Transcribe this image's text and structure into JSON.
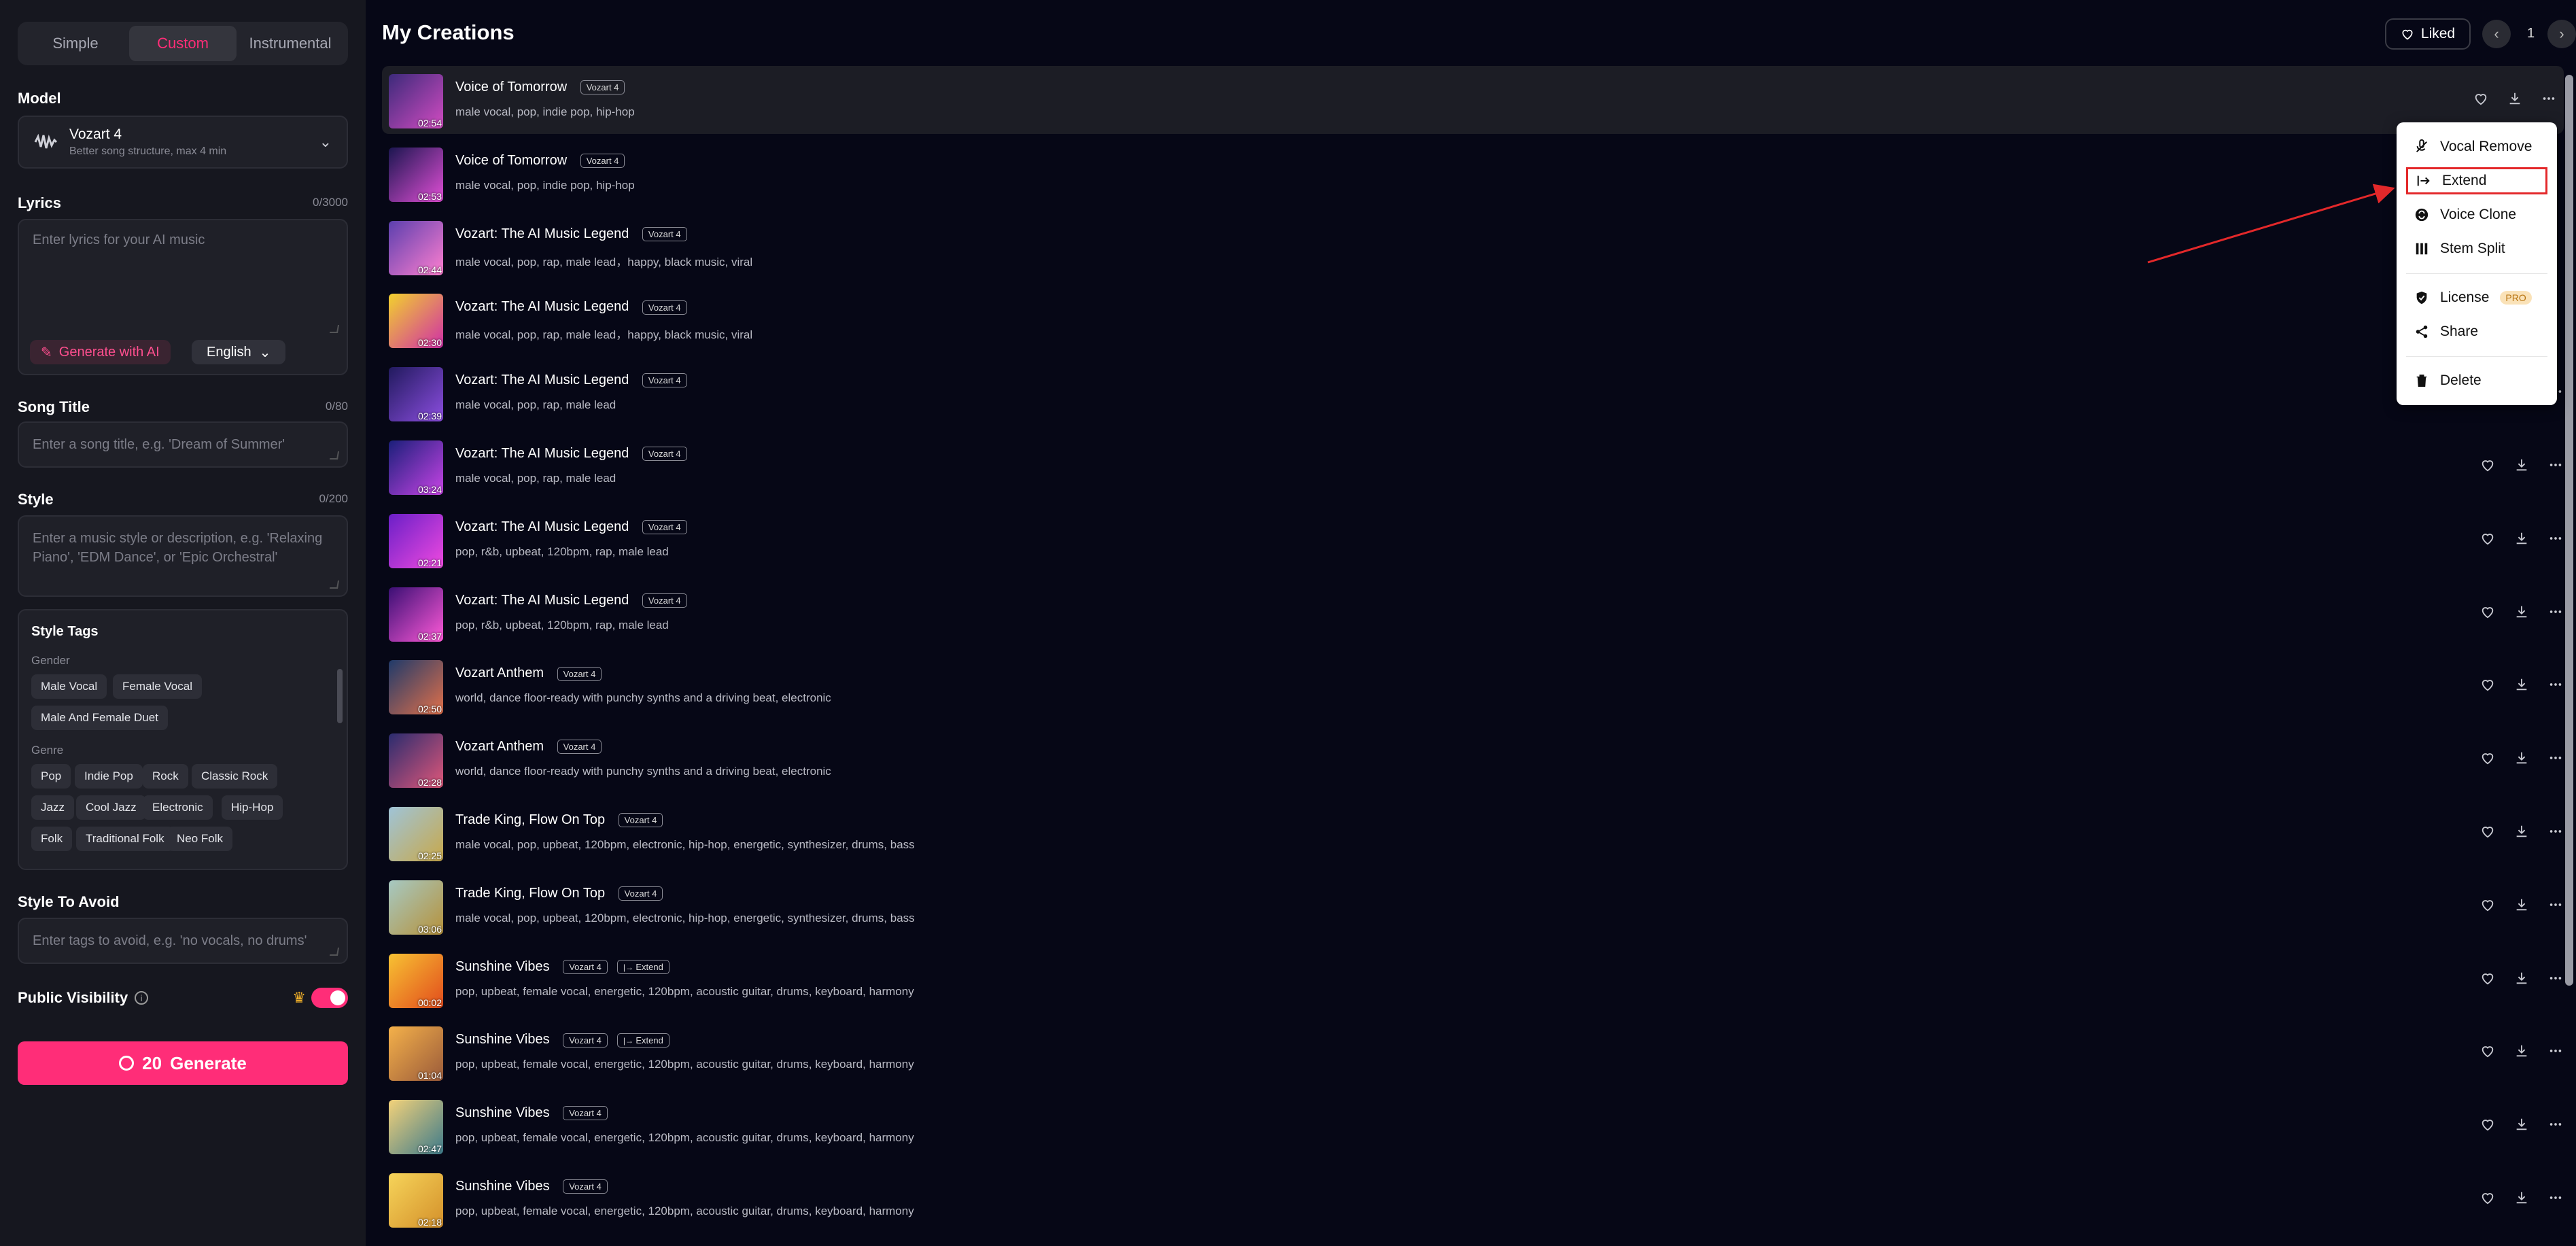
{
  "sidebar": {
    "tabs": [
      "Simple",
      "Custom",
      "Instrumental"
    ],
    "model": {
      "label": "Model",
      "name": "Vozart 4",
      "sub": "Better song structure, max 4 min"
    },
    "lyrics": {
      "label": "Lyrics",
      "count": "0/3000",
      "placeholder": "Enter lyrics for your AI music",
      "gen_ai": "Generate with AI",
      "language": "English"
    },
    "song_title": {
      "label": "Song Title",
      "count": "0/80",
      "placeholder": "Enter a song title, e.g. 'Dream of Summer'"
    },
    "style": {
      "label": "Style",
      "count": "0/200",
      "placeholder_1": "Enter a music style or description, e.g. 'Relaxing",
      "placeholder_2": "Piano', 'EDM Dance', or 'Epic Orchestral'"
    },
    "style_tags": {
      "title": "Style Tags",
      "gender_label": "Gender",
      "gender": [
        "Male Vocal",
        "Female Vocal",
        "Male And Female Duet"
      ],
      "genre_label": "Genre",
      "genre": [
        "Pop",
        "Indie Pop",
        "Rock",
        "Classic Rock",
        "Jazz",
        "Cool Jazz",
        "Electronic",
        "Hip-Hop",
        "Folk",
        "Traditional Folk",
        "Neo Folk"
      ]
    },
    "avoid": {
      "label": "Style To Avoid",
      "placeholder": "Enter tags to avoid, e.g. 'no vocals, no drums'"
    },
    "visibility": {
      "label": "Public Visibility",
      "enabled": true
    },
    "generate": {
      "cost": "20",
      "label": "Generate"
    }
  },
  "main": {
    "title": "My Creations",
    "liked": "Liked",
    "page": "1",
    "songs": [
      {
        "title": "Voice of Tomorrow",
        "model": "Vozart 4",
        "tags": "male vocal, pop, indie pop, hip-hop",
        "duration": "02:54",
        "c1": "#3c2a7a",
        "c2": "#d24cc2"
      },
      {
        "title": "Voice of Tomorrow",
        "model": "Vozart 4",
        "tags": "male vocal, pop, indie pop, hip-hop",
        "duration": "02:53",
        "c1": "#1b1650",
        "c2": "#e14fd6"
      },
      {
        "title": "Vozart: The AI Music Legend",
        "model": "Vozart 4",
        "tags": "male vocal, pop, rap, male lead，happy, black music, viral",
        "duration": "02:44",
        "c1": "#5b3fae",
        "c2": "#ff7fd0"
      },
      {
        "title": "Vozart: The AI Music Legend",
        "model": "Vozart 4",
        "tags": "male vocal, pop, rap, male lead，happy, black music, viral",
        "duration": "02:30",
        "c1": "#f2d12d",
        "c2": "#d02ea7"
      },
      {
        "title": "Vozart: The AI Music Legend",
        "model": "Vozart 4",
        "tags": "male vocal, pop, rap, male lead",
        "duration": "02:39",
        "c1": "#211a5e",
        "c2": "#8c4ee0"
      },
      {
        "title": "Vozart: The AI Music Legend",
        "model": "Vozart 4",
        "tags": "male vocal, pop, rap, male lead",
        "duration": "03:24",
        "c1": "#1a1f7a",
        "c2": "#c844e6"
      },
      {
        "title": "Vozart: The AI Music Legend",
        "model": "Vozart 4",
        "tags": "pop, r&b, upbeat, 120bpm, rap, male lead",
        "duration": "02:21",
        "c1": "#6a1fc7",
        "c2": "#f04ae0"
      },
      {
        "title": "Vozart: The AI Music Legend",
        "model": "Vozart 4",
        "tags": "pop, r&b, upbeat, 120bpm, rap, male lead",
        "duration": "02:37",
        "c1": "#3a0f74",
        "c2": "#ff5ad8"
      },
      {
        "title": "Vozart Anthem",
        "model": "Vozart 4",
        "tags": "world, dance floor-ready with punchy synths and a driving beat, electronic",
        "duration": "02:50",
        "c1": "#1f3a6a",
        "c2": "#e2704a"
      },
      {
        "title": "Vozart Anthem",
        "model": "Vozart 4",
        "tags": "world, dance floor-ready with punchy synths and a driving beat, electronic",
        "duration": "02:28",
        "c1": "#2a2c6e",
        "c2": "#e0577a"
      },
      {
        "title": "Trade King, Flow On Top",
        "model": "Vozart 4",
        "tags": "male vocal, pop, upbeat, 120bpm, electronic, hip-hop, energetic, synthesizer, drums, bass",
        "duration": "02:25",
        "c1": "#9fc4d8",
        "c2": "#c8a84a"
      },
      {
        "title": "Trade King, Flow On Top",
        "model": "Vozart 4",
        "tags": "male vocal, pop, upbeat, 120bpm, electronic, hip-hop, energetic, synthesizer, drums, bass",
        "duration": "03:06",
        "c1": "#a6c9c3",
        "c2": "#b6913a"
      },
      {
        "title": "Sunshine Vibes",
        "model": "Vozart 4",
        "extend": "Extend",
        "tags": "pop, upbeat, female vocal, energetic, 120bpm, acoustic guitar, drums, keyboard, harmony",
        "duration": "00:02",
        "c1": "#f7c233",
        "c2": "#e24b1c"
      },
      {
        "title": "Sunshine Vibes",
        "model": "Vozart 4",
        "extend": "Extend",
        "tags": "pop, upbeat, female vocal, energetic, 120bpm, acoustic guitar, drums, keyboard, harmony",
        "duration": "01:04",
        "c1": "#f4b14a",
        "c2": "#9a5a3a"
      },
      {
        "title": "Sunshine Vibes",
        "model": "Vozart 4",
        "tags": "pop, upbeat, female vocal, energetic, 120bpm, acoustic guitar, drums, keyboard, harmony",
        "duration": "02:47",
        "c1": "#f3d27a",
        "c2": "#3d7a8a"
      },
      {
        "title": "Sunshine Vibes",
        "model": "Vozart 4",
        "tags": "pop, upbeat, female vocal, energetic, 120bpm, acoustic guitar, drums, keyboard, harmony",
        "duration": "02:18",
        "c1": "#f6d45a",
        "c2": "#d4902a"
      }
    ]
  },
  "menu": {
    "vocal_remove": "Vocal Remove",
    "extend": "Extend",
    "voice_clone": "Voice Clone",
    "stem_split": "Stem Split",
    "license": "License",
    "pro": "PRO",
    "share": "Share",
    "delete": "Delete"
  },
  "colors": {
    "accent": "#ff2d78",
    "annotation": "#e3282a"
  }
}
